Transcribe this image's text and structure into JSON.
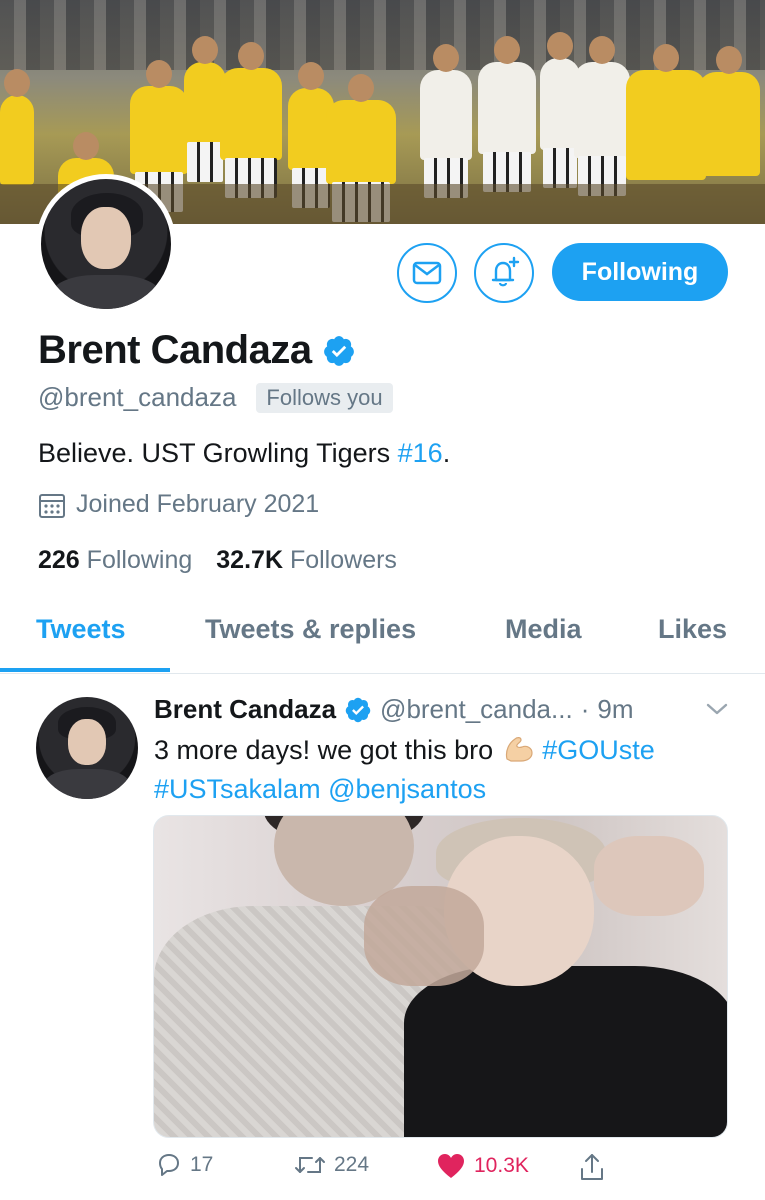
{
  "profile": {
    "display_name": "Brent Candaza",
    "handle": "@brent_candaza",
    "follows_you_label": "Follows you",
    "bio_text": "Believe. UST Growling Tigers ",
    "bio_hashtag": "#16",
    "bio_end": ".",
    "joined_label": "Joined February 2021",
    "following_count": "226",
    "following_label": "Following",
    "followers_count": "32.7K",
    "followers_label": "Followers",
    "verified": true
  },
  "actions": {
    "follow_button_label": "Following",
    "message_icon": "envelope-icon",
    "notify_icon": "bell-plus-icon"
  },
  "tabs": [
    {
      "label": "Tweets",
      "active": true
    },
    {
      "label": "Tweets & replies",
      "active": false
    },
    {
      "label": "Media",
      "active": false
    },
    {
      "label": "Likes",
      "active": false
    }
  ],
  "tweet": {
    "author_name": "Brent Candaza",
    "author_handle": "@brent_canda...",
    "separator": "·",
    "time": "9m",
    "text_line1": "3 more days! we got this bro ",
    "hashtag1": "#GOUste",
    "hashtag2": "#USTsakalam",
    "mention": "@benjsantos",
    "reply_count": "17",
    "retweet_count": "224",
    "like_count": "10.3K",
    "liked": true
  },
  "colors": {
    "accent": "#1da1f2",
    "like": "#e0245e",
    "secondary_text": "#657786"
  }
}
